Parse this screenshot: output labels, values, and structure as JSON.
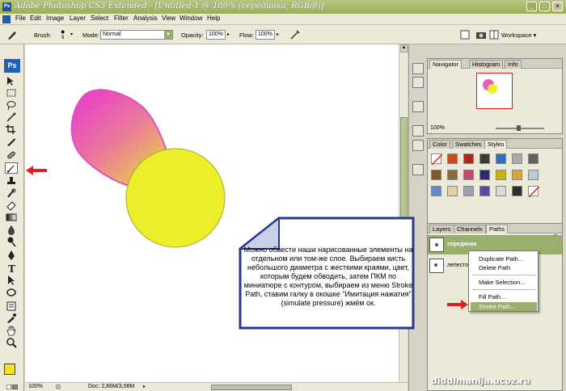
{
  "window": {
    "title": "Adobe Photoshop CS3 Extended - [Untitled-1 @ 100% (серединка, RGB/8)]",
    "minimize": "_",
    "maximize": "□",
    "close": "×"
  },
  "menu": [
    "File",
    "Edit",
    "Image",
    "Layer",
    "Select",
    "Filter",
    "Analysis",
    "View",
    "Window",
    "Help"
  ],
  "options": {
    "brush_label": "Brush:",
    "brush_size": "9",
    "mode_label": "Mode:",
    "mode_value": "Normal",
    "opacity_label": "Opacity:",
    "opacity_value": "100%",
    "flow_label": "Flow:",
    "flow_value": "100%",
    "workspace_label": "Workspace ▾"
  },
  "toolbar": {
    "logo": "Ps",
    "tools": [
      "move-tool",
      "marquee-tool",
      "lasso-tool",
      "magic-wand-tool",
      "crop-tool",
      "slice-tool",
      "healing-tool",
      "brush-tool",
      "clone-stamp-tool",
      "history-brush-tool",
      "eraser-tool",
      "gradient-tool",
      "blur-tool",
      "dodge-tool",
      "pen-tool",
      "type-tool",
      "path-selection-tool",
      "shape-tool",
      "notes-tool",
      "eyedropper-tool",
      "hand-tool",
      "zoom-tool"
    ],
    "selected_tool": "brush-tool",
    "foreground_color": "#f5e21a",
    "background_color": "#e041b8"
  },
  "status": {
    "zoom": "100%",
    "doc": "Doc: 2,86M/3,08M"
  },
  "navigator": {
    "tabs": [
      "Navigator",
      "Histogram",
      "Info"
    ],
    "zoom": "100%"
  },
  "styles_panel": {
    "tabs": [
      "Color",
      "Swatches",
      "Styles"
    ]
  },
  "paths_panel": {
    "tabs": [
      "Layers",
      "Channels",
      "Paths"
    ],
    "paths": [
      "серединка",
      "лепесток"
    ]
  },
  "context_menu": {
    "items": [
      "Duplicate Path...",
      "Delete Path",
      "Make Selection...",
      "Fill Path...",
      "Stroke Path..."
    ],
    "highlighted": "Stroke Path..."
  },
  "callout": {
    "text": "Можно обвести наши нарисованные элементы на отдельном или том-же слое. Выбираем кисть небольшого диаметра с жесткими краями, цвет, которым будем обводить, затем ПКМ по миниатюре с контуром, выбираем из меню Stroke Path, ставим галку в окошке \"Имитация нажатия\" (simulate pressure) жмём ок."
  },
  "watermark": "diddlmanija.ucoz.ru",
  "colors": {
    "title_bar": "#9aae5b",
    "pink": "#e94fbf",
    "yellow": "#ecee2a",
    "arrow": "#e02020",
    "callout_border": "#243a8c",
    "highlight": "#9aae6d"
  }
}
